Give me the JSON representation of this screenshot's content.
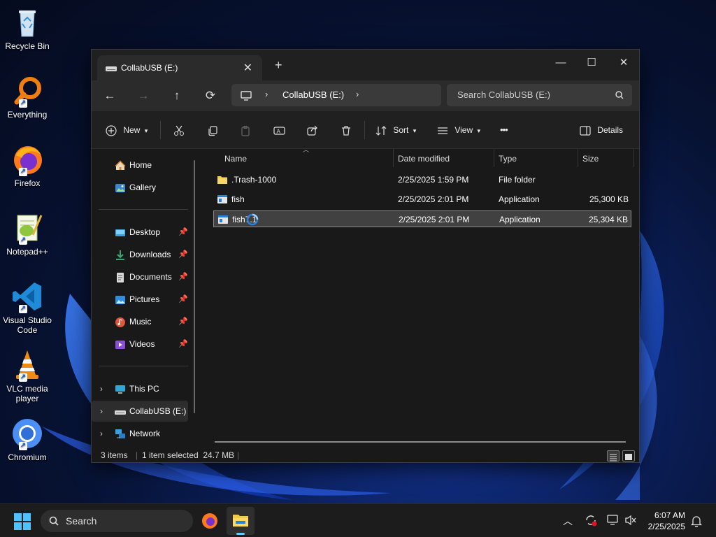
{
  "desktop": {
    "icons": [
      {
        "label": "Recycle Bin",
        "icon": "recycle-bin-icon"
      },
      {
        "label": "Everything",
        "icon": "everything-search-icon"
      },
      {
        "label": "Firefox",
        "icon": "firefox-icon"
      },
      {
        "label": "Notepad++",
        "icon": "notepadpp-icon"
      },
      {
        "label": "Visual Studio Code",
        "icon": "vscode-icon"
      },
      {
        "label": "VLC media player",
        "icon": "vlc-icon"
      },
      {
        "label": "Chromium",
        "icon": "chromium-icon"
      }
    ]
  },
  "window": {
    "tab_title": "CollabUSB (E:)",
    "new_tab": "+",
    "controls": {
      "minimize": "—",
      "maximize": "☐",
      "close": "✕"
    },
    "nav": {
      "back": "←",
      "forward": "→",
      "up": "↑",
      "refresh": "⟳"
    },
    "breadcrumb": [
      "CollabUSB (E:)"
    ],
    "search_placeholder": "Search CollabUSB (E:)",
    "toolbar": {
      "new_label": "New",
      "sort_label": "Sort",
      "view_label": "View",
      "more_label": "•••",
      "details_label": "Details"
    },
    "sidebar": {
      "quick": [
        {
          "label": "Home",
          "icon": "home-icon"
        },
        {
          "label": "Gallery",
          "icon": "gallery-icon"
        }
      ],
      "pinned": [
        {
          "label": "Desktop",
          "icon": "desktop-folder-icon"
        },
        {
          "label": "Downloads",
          "icon": "downloads-folder-icon"
        },
        {
          "label": "Documents",
          "icon": "documents-folder-icon"
        },
        {
          "label": "Pictures",
          "icon": "pictures-folder-icon"
        },
        {
          "label": "Music",
          "icon": "music-folder-icon"
        },
        {
          "label": "Videos",
          "icon": "videos-folder-icon"
        }
      ],
      "locations": [
        {
          "label": "This PC",
          "icon": "this-pc-icon"
        },
        {
          "label": "CollabUSB (E:)",
          "icon": "usb-drive-icon",
          "selected": true
        },
        {
          "label": "Network",
          "icon": "network-icon"
        }
      ]
    },
    "columns": [
      "Name",
      "Date modified",
      "Type",
      "Size"
    ],
    "files": [
      {
        "name": ".Trash-1000",
        "date": "2/25/2025 1:59 PM",
        "type": "File folder",
        "size": "",
        "icon": "folder-icon"
      },
      {
        "name": "fish",
        "date": "2/25/2025 2:01 PM",
        "type": "Application",
        "size": "25,300 KB",
        "icon": "application-icon"
      },
      {
        "name": "fish7.1",
        "date": "2/25/2025 2:01 PM",
        "type": "Application",
        "size": "25,304 KB",
        "icon": "application-icon",
        "selected": true
      }
    ],
    "status": {
      "items": "3 items",
      "selection": "1 item selected  24.7 MB"
    }
  },
  "taskbar": {
    "search_placeholder": "Search",
    "time": "6:07 AM",
    "date": "2/25/2025"
  },
  "colors": {
    "accent": "#60cdff",
    "selection": "#414141",
    "folder": "#f4c84a"
  }
}
